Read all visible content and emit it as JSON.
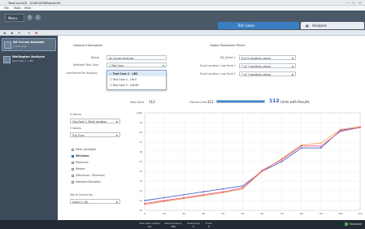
{
  "window": {
    "title": "TestCrunch® - D:\\MCSOM\\Result.tsf",
    "controls": "— ☐ ✕"
  },
  "menu": [
    "File",
    "Tools",
    "Help"
  ],
  "ribbon": {
    "menu_button": "Menu",
    "icons": [
      "?",
      "i"
    ]
  },
  "tabs": {
    "test_cases": "Test Cases",
    "analyses": "Analyses"
  },
  "toolbar": {
    "icons": [
      "≣",
      "≣",
      "✎",
      "+",
      "✖"
    ]
  },
  "sidebar": {
    "items": [
      {
        "title": "All Curves Analysis",
        "subtitle": "1 Test Case"
      },
      {
        "title": "Wellington Analysis",
        "subtitle": "Test Case 1 - LBS"
      }
    ]
  },
  "general": {
    "heading": "General Information",
    "name_label": "Name",
    "name_value": "All Curves Analysis",
    "test_case_label": "Selected Test Case",
    "test_case_value": "1 Test Case",
    "considered_label": "Considered for Analysis",
    "dropdown": [
      "Test Case 1 - LBS",
      "Test Case 2 - LRLS",
      "Test Case 3 - LRLSN"
    ]
  },
  "filters": {
    "heading": "Global Parameter Filters",
    "rows": [
      {
        "label": "SB_Select 1",
        "value": "6 of 9 variables values"
      },
      {
        "label": "Fault Location, Line Fault 1",
        "value": "7 of 7 variables values"
      },
      {
        "label": "Fault Location, Line Fault 2",
        "value": "7 of 7 variables values"
      }
    ]
  },
  "counts": {
    "total_label": "Total Units",
    "total_value": "112",
    "filtered_label": "Filtered Units",
    "filtered_value": "112",
    "results_value": "112",
    "results_text": "Units with Results",
    "progress": 1.0
  },
  "axes_controls": {
    "x_label": "X Values",
    "x_value": "Clip Fault 1 (Fault Location",
    "y_label": "Y Values",
    "y_value": "Trip Time",
    "stats": [
      "Mean (Average)",
      "Minimum",
      "Maximum",
      "Median",
      "(Maximum - Minimum)",
      "Standard Deviation"
    ],
    "stats_checked": 1,
    "set_label": "Set of Curves for...",
    "set_value": "Select 1: (8)"
  },
  "chart_data": {
    "type": "line",
    "x": [
      0,
      10,
      20,
      30,
      40,
      50,
      60,
      70,
      80,
      90,
      100,
      110
    ],
    "xticks": [
      "0",
      "10",
      "20",
      "30",
      "40",
      "50",
      "60",
      "70",
      "80",
      "90",
      "100",
      "110"
    ],
    "yticks": [
      "10",
      "11",
      "12",
      "13",
      "14",
      "15",
      "16",
      "17",
      "18",
      "19",
      "20"
    ],
    "xlim": [
      0,
      110
    ],
    "ylim": [
      10,
      20
    ],
    "ylabel": "ms",
    "series": [
      {
        "color": "#4d63c9",
        "values": [
          11.0,
          11.3,
          11.6,
          11.9,
          12.2,
          12.5,
          14.0,
          15.0,
          16.4,
          16.4,
          18.2,
          18.5
        ]
      },
      {
        "color": "#f0a35a",
        "values": [
          10.6,
          10.9,
          11.2,
          11.5,
          11.8,
          12.2,
          14.0,
          15.3,
          16.7,
          16.9,
          18.3,
          18.6
        ]
      },
      {
        "color": "#e85b8c",
        "values": [
          10.7,
          11.0,
          11.3,
          11.6,
          11.9,
          12.3,
          14.1,
          15.2,
          16.6,
          16.6,
          18.1,
          18.5
        ]
      }
    ]
  },
  "status": {
    "items": [
      {
        "label": "Total Units Loaded",
        "value": "1/1"
      },
      {
        "label": "Executed Runs",
        "value": "336"
      },
      {
        "label": "Failed Runs",
        "value": "0"
      },
      {
        "label": "Errors",
        "value": "0"
      }
    ],
    "right": "Hardware"
  }
}
